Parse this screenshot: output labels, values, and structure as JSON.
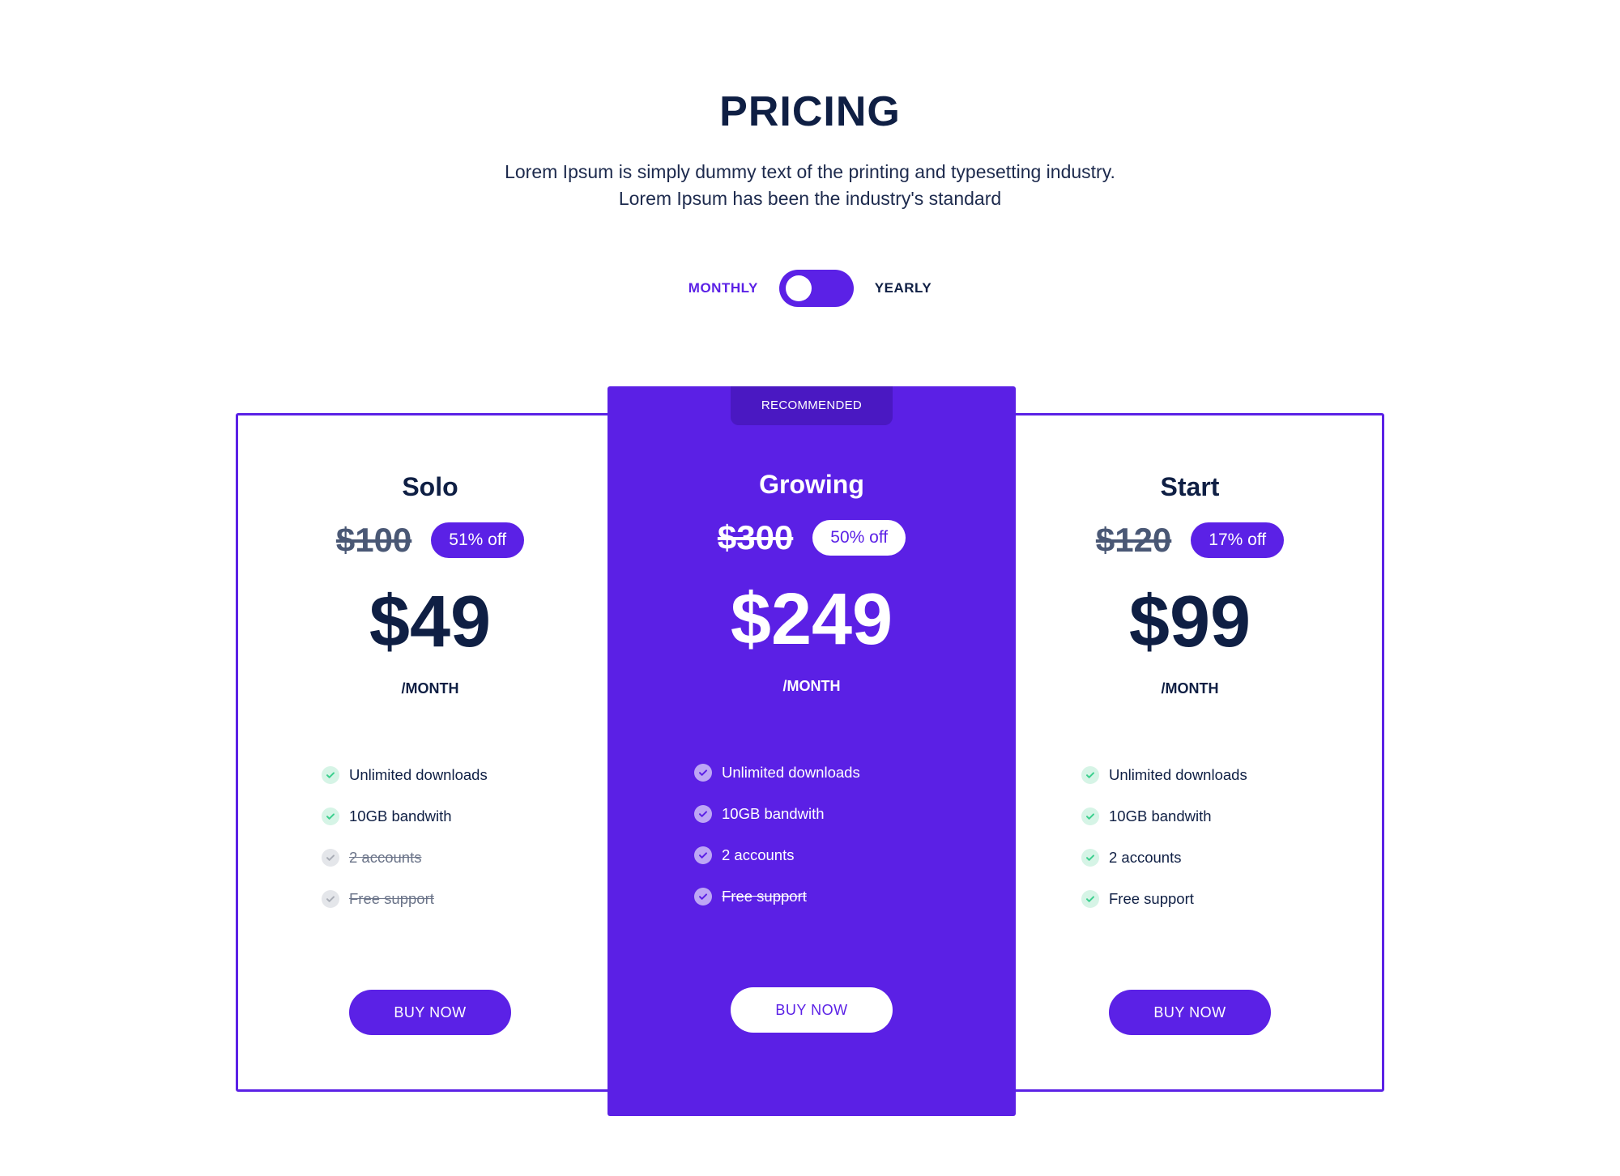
{
  "header": {
    "title": "PRICING",
    "subtitle": "Lorem Ipsum is simply dummy text of the printing and typesetting industry. Lorem Ipsum has been the industry's standard"
  },
  "billing_toggle": {
    "monthly_label": "MONTHLY",
    "yearly_label": "YEARLY",
    "selected": "monthly"
  },
  "plans": [
    {
      "name": "Solo",
      "original_price": "$100",
      "discount": "51% off",
      "price": "$49",
      "period": "/MONTH",
      "features": [
        {
          "text": "Unlimited downloads",
          "included": true
        },
        {
          "text": "10GB bandwith",
          "included": true
        },
        {
          "text": "2 accounts",
          "included": false
        },
        {
          "text": "Free support",
          "included": false
        }
      ],
      "button": "BUY NOW"
    },
    {
      "name": "Growing",
      "ribbon": "RECOMMENDED",
      "original_price": "$300",
      "discount": "50% off",
      "price": "$249",
      "period": "/MONTH",
      "features": [
        {
          "text": "Unlimited downloads",
          "included": true
        },
        {
          "text": "10GB bandwith",
          "included": true
        },
        {
          "text": "2 accounts",
          "included": true
        },
        {
          "text": "Free support",
          "included": false
        }
      ],
      "button": "BUY NOW"
    },
    {
      "name": "Start",
      "original_price": "$120",
      "discount": "17% off",
      "price": "$99",
      "period": "/MONTH",
      "features": [
        {
          "text": "Unlimited downloads",
          "included": true
        },
        {
          "text": "10GB bandwith",
          "included": true
        },
        {
          "text": "2 accounts",
          "included": true
        },
        {
          "text": "Free support",
          "included": true
        }
      ],
      "button": "BUY NOW"
    }
  ],
  "colors": {
    "accent": "#5b21e6",
    "heading": "#0f1f44",
    "check_green": "#3ccf8e"
  },
  "icons": {
    "feature_check": "check-circle-icon"
  }
}
